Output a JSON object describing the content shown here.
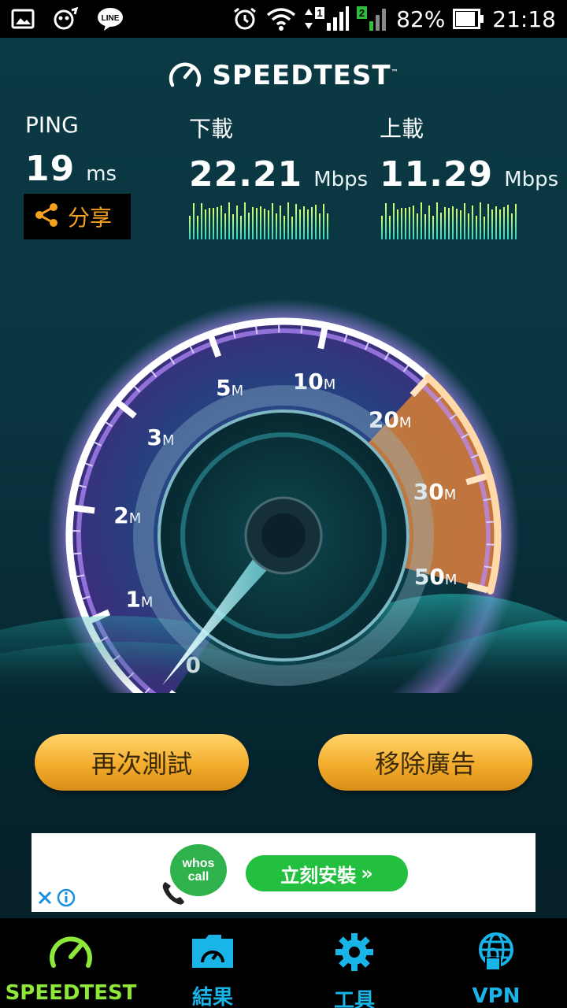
{
  "status_bar": {
    "battery": "82%",
    "time": "21:18",
    "icons": [
      "image-icon",
      "app-icon",
      "line-icon",
      "alarm-icon",
      "wifi-icon",
      "sim1-signal-icon",
      "sim2-signal-icon",
      "battery-icon"
    ],
    "line_badge": "LINE"
  },
  "header": {
    "brand": "SPEEDTEST",
    "trademark": "™"
  },
  "results": {
    "ping": {
      "label": "PING",
      "value": "19",
      "unit": "ms"
    },
    "download": {
      "label": "下載",
      "value": "22.21",
      "unit": "Mbps"
    },
    "upload": {
      "label": "上載",
      "value": "11.29",
      "unit": "Mbps"
    }
  },
  "share": {
    "label": "分享"
  },
  "gauge": {
    "ticks": [
      {
        "num": "0",
        "unit": ""
      },
      {
        "num": "1",
        "unit": "M"
      },
      {
        "num": "2",
        "unit": "M"
      },
      {
        "num": "3",
        "unit": "M"
      },
      {
        "num": "5",
        "unit": "M"
      },
      {
        "num": "10",
        "unit": "M"
      },
      {
        "num": "20",
        "unit": "M"
      },
      {
        "num": "30",
        "unit": "M"
      },
      {
        "num": "50",
        "unit": "M"
      }
    ],
    "needle_value": 0,
    "accent_color": "#f08a2a",
    "ring_color": "#b88cff"
  },
  "buttons": {
    "test_again": "再次測試",
    "remove_ads": "移除廣告"
  },
  "ad": {
    "logo_line1": "whos",
    "logo_line2": "call",
    "cta": "立刻安裝",
    "cta_arrows": "»"
  },
  "bottom_nav": [
    {
      "label": "SPEEDTEST",
      "icon": "speedometer-icon",
      "color": "#8ee83a",
      "active": true
    },
    {
      "label": "結果",
      "icon": "results-folder-icon",
      "color": "#19b5e8",
      "active": false
    },
    {
      "label": "工具",
      "icon": "gear-icon",
      "color": "#19b5e8",
      "active": false
    },
    {
      "label": "VPN",
      "icon": "vpn-globe-lock-icon",
      "color": "#19b5e8",
      "active": false
    }
  ]
}
